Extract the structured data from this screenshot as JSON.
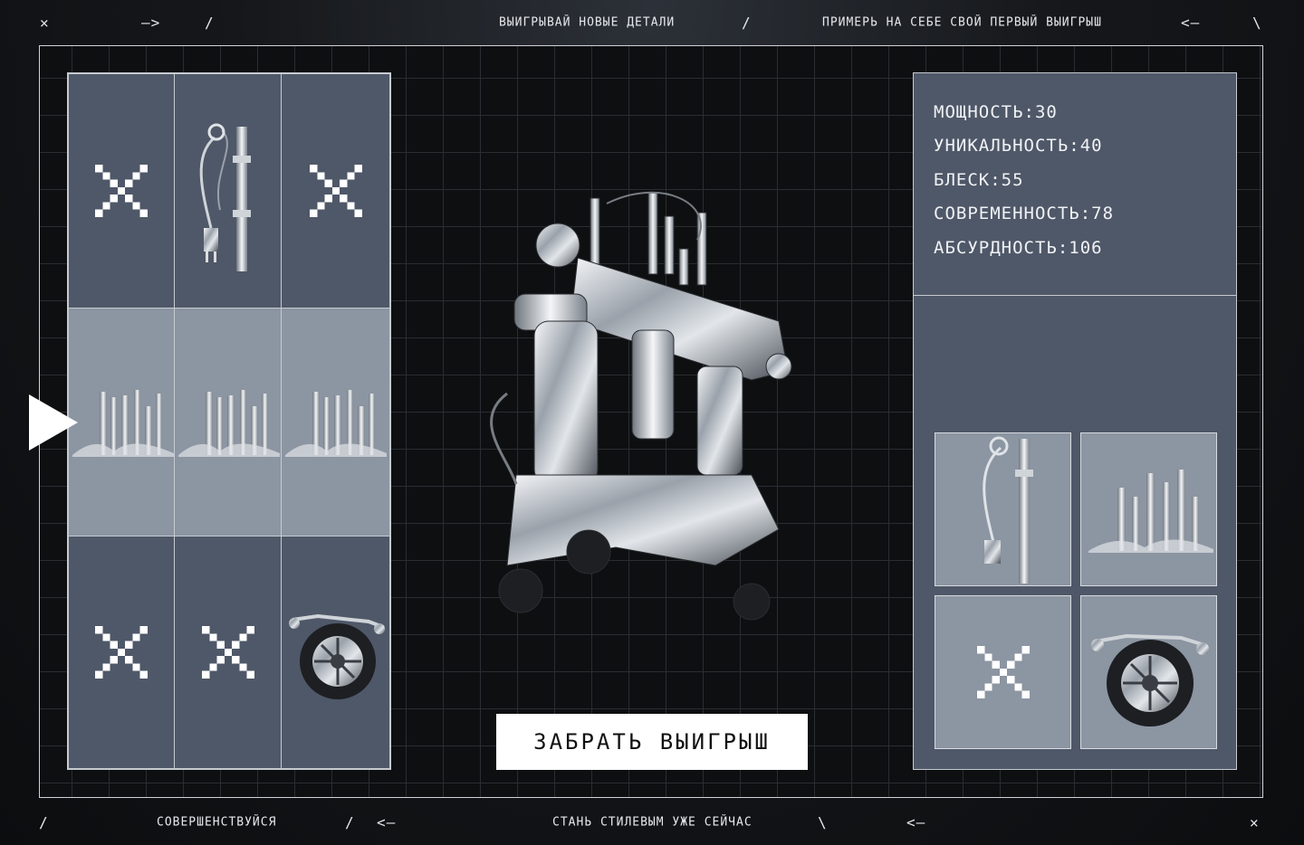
{
  "top_ticker": {
    "close_glyph": "✕",
    "arrow_right": "–>",
    "slash_a": "/",
    "phrase_1": "ВЫИГРЫВАЙ НОВЫЕ ДЕТАЛИ",
    "slash_b": "/",
    "phrase_2": "ПРИМЕРЬ НА СЕБЕ СВОЙ ПЕРВЫЙ ВЫИГРЫШ",
    "arrow_left": "<–",
    "backslash": "\\"
  },
  "bottom_ticker": {
    "slash_a": "/",
    "phrase_1": "СОВЕРШЕНСТВУЙСЯ",
    "slash_b": "/",
    "arrow_left_a": "<–",
    "phrase_2": "СТАНЬ СТИЛЕВЫМ УЖЕ СЕЙЧАС",
    "backslash": "\\",
    "arrow_left_b": "<–",
    "close_glyph": "✕"
  },
  "stats": [
    {
      "label": "МОЩНОСТЬ",
      "value": "30"
    },
    {
      "label": "УНИКАЛЬНОСТЬ",
      "value": "40"
    },
    {
      "label": "БЛЕСК",
      "value": "55"
    },
    {
      "label": "СОВРЕМЕННОСТЬ",
      "value": "78"
    },
    {
      "label": "АБСУРДНОСТЬ",
      "value": "106"
    }
  ],
  "stats_text": [
    "МОЩНОСТЬ:30",
    "УНИКАЛЬНОСТЬ:40",
    "БЛЕСК:55",
    "СОВРЕМЕННОСТЬ:78",
    "АБСУРДНОСТЬ:106"
  ],
  "claim_button": "ЗАБРАТЬ ВЫИГРЫШ",
  "slots_left": [
    [
      "empty",
      "arm-part",
      "empty"
    ],
    [
      "pipes-part",
      "pipes-part",
      "pipes-part"
    ],
    [
      "empty",
      "empty",
      "wheel-part"
    ]
  ],
  "slots_inventory": [
    "arm-part",
    "pipes-part",
    "empty",
    "wheel-part"
  ],
  "colors": {
    "panel": "#4f5868",
    "panel_highlight": "#8c95a2",
    "border": "#c6cbd1",
    "background": "#0e0f11",
    "button": "#ffffff"
  }
}
